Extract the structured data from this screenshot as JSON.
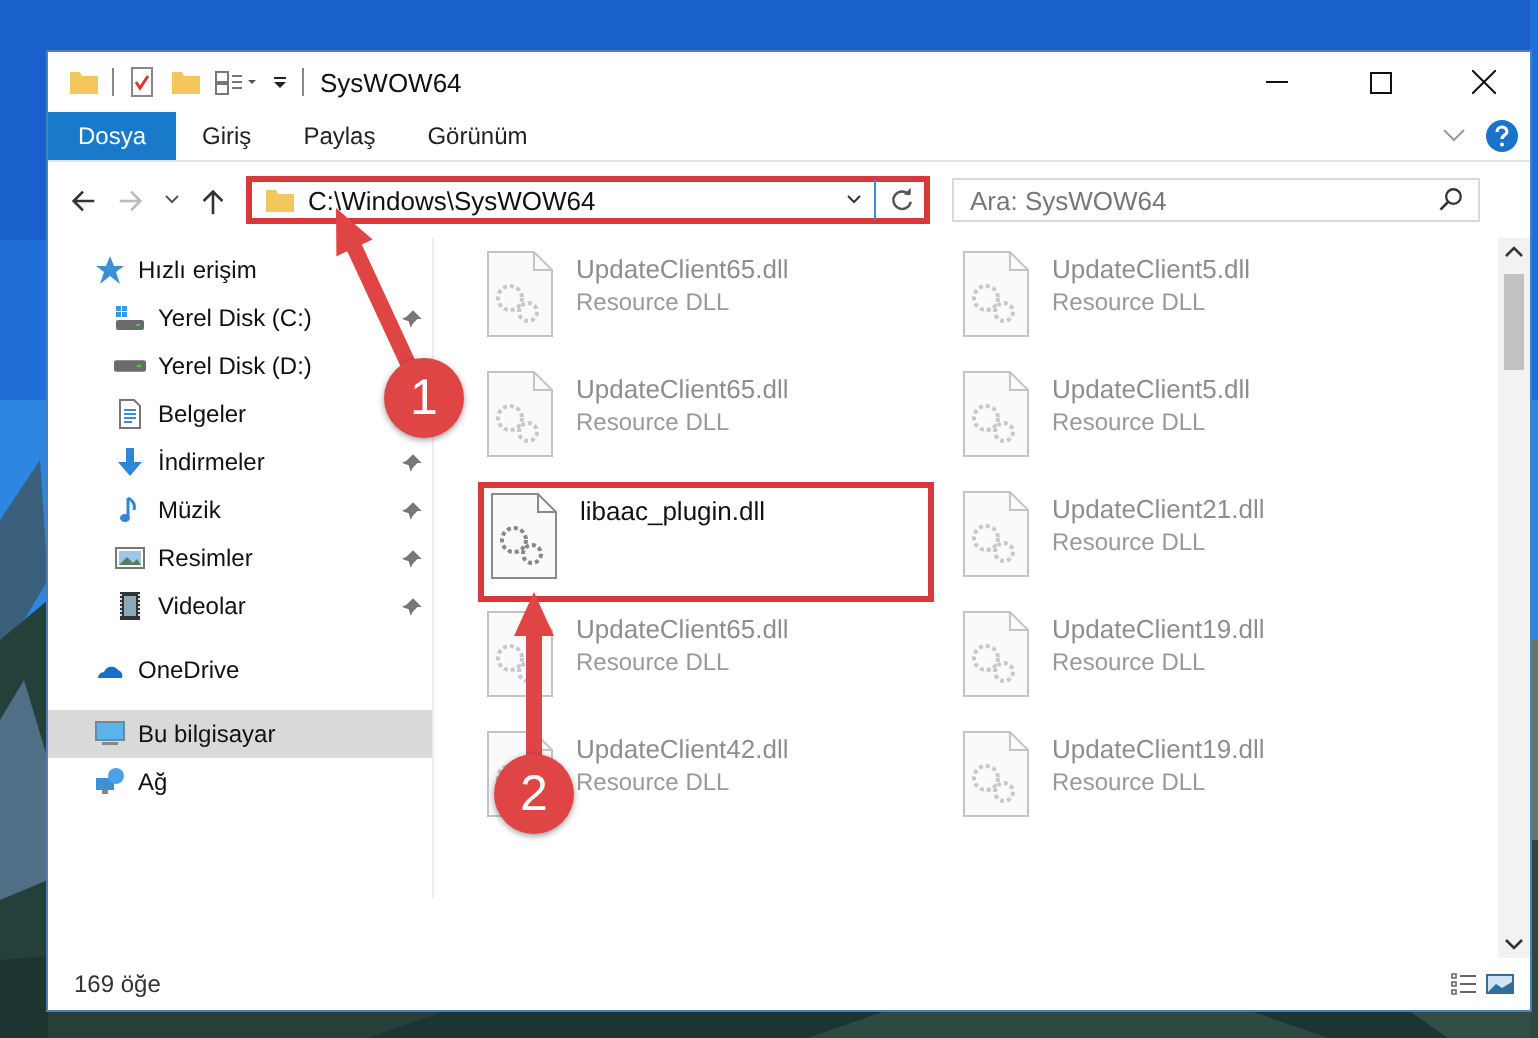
{
  "window": {
    "title": "SysWOW64"
  },
  "ribbon_tabs": [
    {
      "label": "Dosya",
      "selected": true
    },
    {
      "label": "Giriş",
      "selected": false
    },
    {
      "label": "Paylaş",
      "selected": false
    },
    {
      "label": "Görünüm",
      "selected": false
    }
  ],
  "address_bar": {
    "path": "C:\\Windows\\SysWOW64",
    "highlighted": true
  },
  "search": {
    "placeholder": "Ara: SysWOW64"
  },
  "sidebar": {
    "items": [
      {
        "label": "Hızlı erişim",
        "kind": "star",
        "selected": false,
        "children": [
          {
            "label": "Yerel Disk (C:)",
            "kind": "drive-win",
            "pinned": true,
            "selected": false
          },
          {
            "label": "Yerel Disk (D:)",
            "kind": "drive",
            "pinned": false,
            "selected": false
          },
          {
            "label": "Belgeler",
            "kind": "document",
            "pinned": false,
            "selected": false
          },
          {
            "label": "İndirmeler",
            "kind": "download",
            "pinned": true,
            "selected": false
          },
          {
            "label": "Müzik",
            "kind": "music",
            "pinned": true,
            "selected": false
          },
          {
            "label": "Resimler",
            "kind": "pictures",
            "pinned": true,
            "selected": false
          },
          {
            "label": "Videolar",
            "kind": "video",
            "pinned": true,
            "selected": false
          }
        ]
      },
      {
        "label": "OneDrive",
        "kind": "cloud",
        "selected": false
      },
      {
        "label": "Bu bilgisayar",
        "kind": "computer",
        "selected": true
      },
      {
        "label": "Ağ",
        "kind": "network",
        "selected": false
      }
    ]
  },
  "files": [
    {
      "name": "UpdateClient65.dll",
      "type": "Resource DLL",
      "kind": "blurred"
    },
    {
      "name": "UpdateClient5.dll",
      "type": "Resource DLL",
      "kind": "blurred"
    },
    {
      "name": "UpdateClient65.dll",
      "type": "Resource DLL",
      "kind": "blurred"
    },
    {
      "name": "UpdateClient5.dll",
      "type": "Resource DLL",
      "kind": "blurred"
    },
    {
      "name": "libaac_plugin.dll",
      "kind": "highlighted"
    },
    {
      "name": "UpdateClient21.dll",
      "type": "Resource DLL",
      "kind": "blurred"
    },
    {
      "name": "UpdateClient65.dll",
      "type": "Resource DLL",
      "kind": "blurred"
    },
    {
      "name": "UpdateClient19.dll",
      "type": "Resource DLL",
      "kind": "blurred"
    },
    {
      "name": "UpdateClient42.dll",
      "type": "Resource DLL",
      "kind": "blurred"
    },
    {
      "name": "UpdateClient19.dll",
      "type": "Resource DLL",
      "kind": "blurred"
    }
  ],
  "annotations": [
    {
      "label": "1"
    },
    {
      "label": "2"
    }
  ],
  "status_bar": {
    "count": "169 öğe"
  }
}
